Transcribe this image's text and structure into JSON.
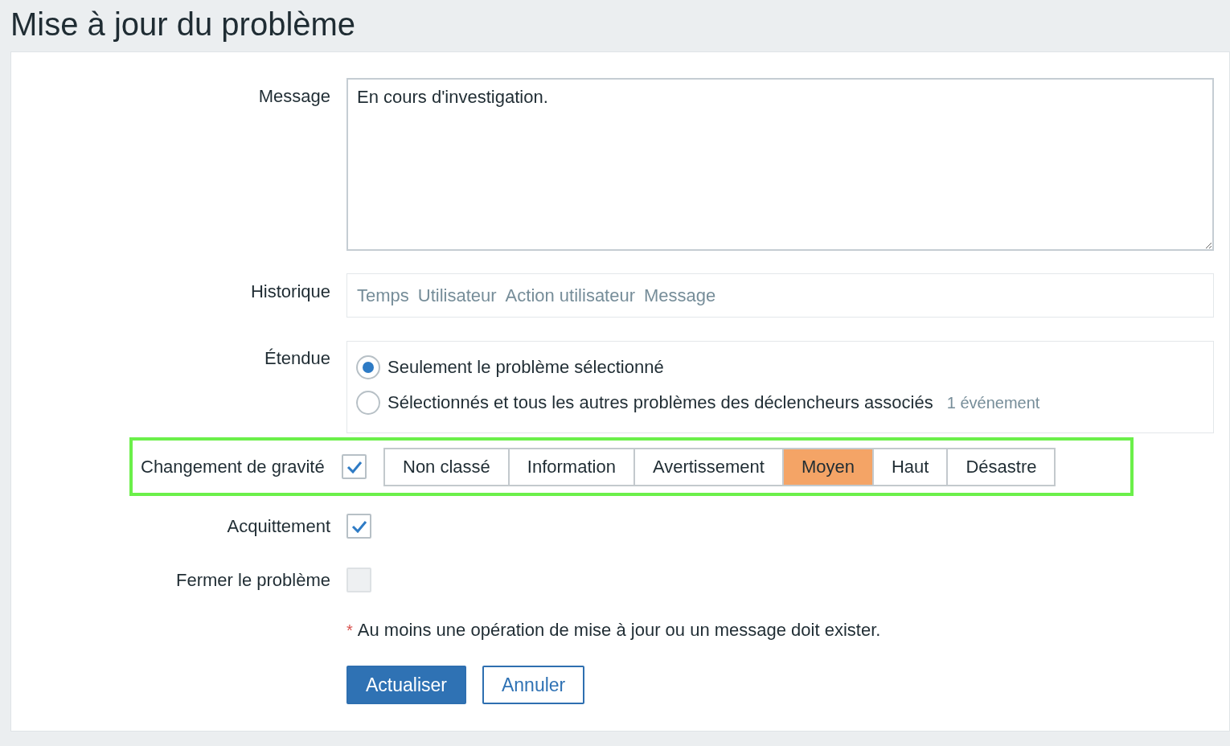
{
  "title": "Mise à jour du problème",
  "message": {
    "label": "Message",
    "value": "En cours d'investigation."
  },
  "history": {
    "label": "Historique",
    "columns": [
      "Temps",
      "Utilisateur",
      "Action utilisateur",
      "Message"
    ]
  },
  "scope": {
    "label": "Étendue",
    "options": [
      {
        "label": "Seulement le problème sélectionné",
        "selected": true
      },
      {
        "label": "Sélectionnés et tous les autres problèmes des déclencheurs associés",
        "selected": false,
        "note": "1 événement"
      }
    ]
  },
  "severity": {
    "label": "Changement de gravité",
    "checked": true,
    "highlighted": true,
    "options": [
      {
        "label": "Non classé",
        "selected": false
      },
      {
        "label": "Information",
        "selected": false
      },
      {
        "label": "Avertissement",
        "selected": false
      },
      {
        "label": "Moyen",
        "selected": true
      },
      {
        "label": "Haut",
        "selected": false
      },
      {
        "label": "Désastre",
        "selected": false
      }
    ]
  },
  "acknowledge": {
    "label": "Acquittement",
    "checked": true
  },
  "close": {
    "label": "Fermer le problème",
    "checked": false,
    "disabled": true
  },
  "note": {
    "mark": "*",
    "text": "Au moins une opération de mise à jour ou un message doit exister."
  },
  "buttons": [
    {
      "label": "Actualiser",
      "kind": "primary"
    },
    {
      "label": "Annuler",
      "kind": "secondary"
    }
  ]
}
